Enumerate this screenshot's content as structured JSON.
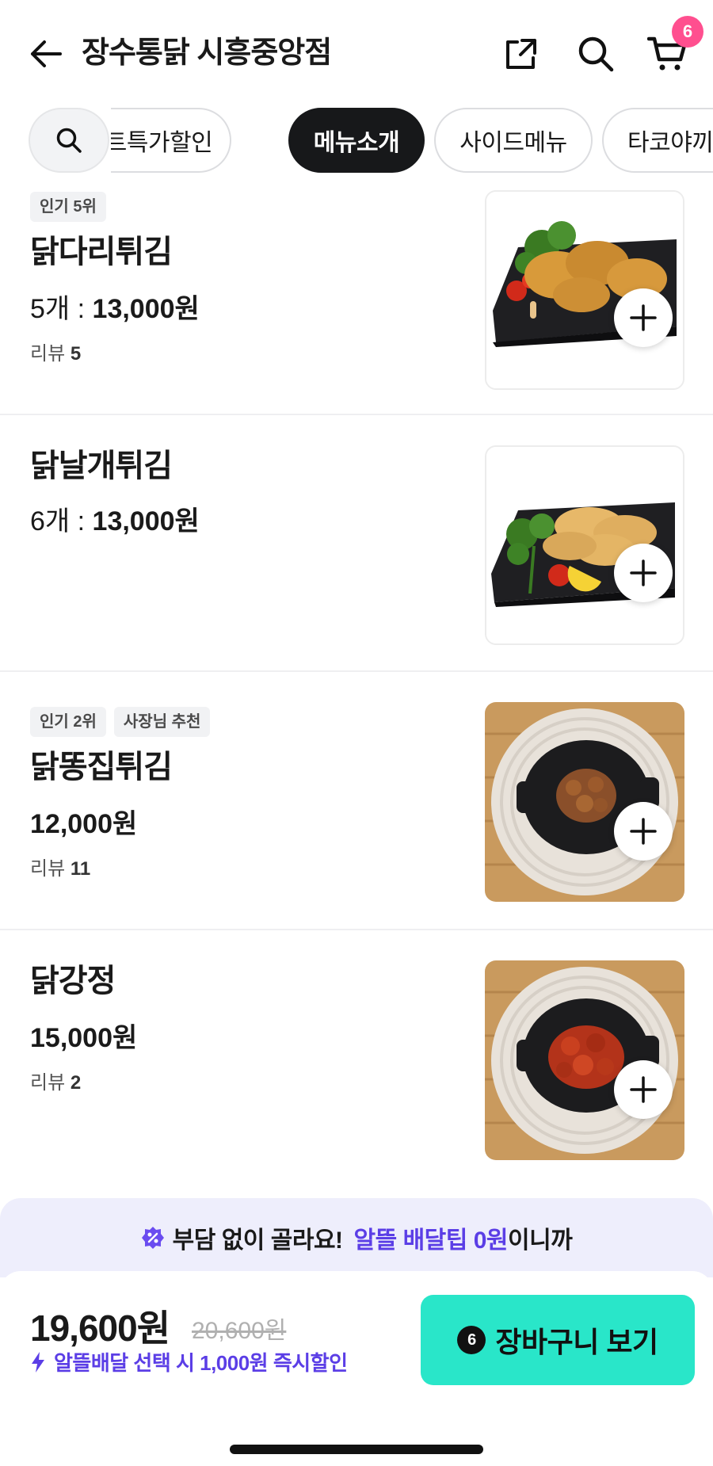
{
  "header": {
    "store_name": "장수통닭 시흥중앙점",
    "cart_count": "6"
  },
  "tabs": [
    {
      "label": "벤트특가할인",
      "active": false
    },
    {
      "label": "메뉴소개",
      "active": true
    },
    {
      "label": "사이드메뉴",
      "active": false
    },
    {
      "label": "타코야끼",
      "active": false
    }
  ],
  "menu": [
    {
      "badges": [
        "인기 5위"
      ],
      "name": "닭다리튀김",
      "qty": "5개 : ",
      "price": "13,000원",
      "reviews_label": "리뷰",
      "reviews_count": "5",
      "image": "fried-drumsticks-on-black-plate"
    },
    {
      "badges": [],
      "name": "닭날개튀김",
      "qty": "6개 : ",
      "price": "13,000원",
      "reviews_label": "",
      "reviews_count": "",
      "image": "fried-wings-on-black-plate"
    },
    {
      "badges": [
        "인기 2위",
        "사장님 추천"
      ],
      "name": "닭똥집튀김",
      "qty": "",
      "price": "12,000원",
      "reviews_label": "리뷰",
      "reviews_count": "11",
      "image": "fried-gizzards-in-black-pan"
    },
    {
      "badges": [],
      "name": "닭강정",
      "qty": "",
      "price": "15,000원",
      "reviews_label": "리뷰",
      "reviews_count": "2",
      "image": "sweet-spicy-chicken-in-black-pan"
    }
  ],
  "promo": {
    "text": "부담 없이 골라요!",
    "highlight": "알뜰 배달팁 0원",
    "suffix": "이니까"
  },
  "cart": {
    "total": "19,600원",
    "original": "20,600원",
    "discount_note": "알뜰배달 선택 시 1,000원 즉시할인",
    "cta_label": "장바구니 보기",
    "cta_count": "6"
  },
  "colors": {
    "accent_mint": "#29e6c9",
    "accent_purple": "#5b3ee6",
    "badge_pink": "#ff4f8f"
  }
}
